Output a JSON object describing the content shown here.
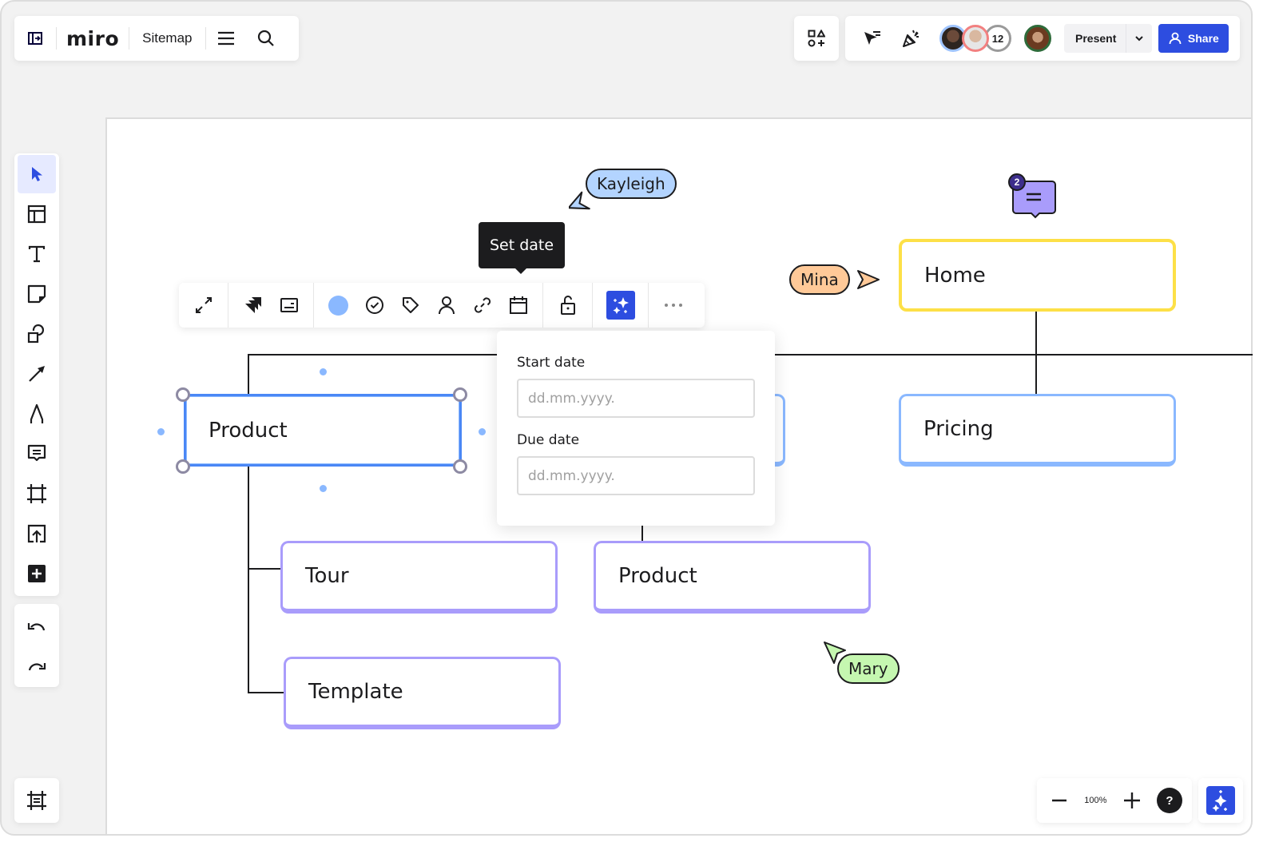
{
  "header": {
    "logo": "miro",
    "board_name": "Sitemap",
    "collaborator_count": "12",
    "present_label": "Present",
    "share_label": "Share"
  },
  "icons": {
    "sidebar_toggle": "sidebar-toggle-icon",
    "menu": "hamburger-menu-icon",
    "search": "search-icon",
    "apps": "shapes-apps-icon",
    "cursor_follow": "cursor-filter-icon",
    "reactions": "party-popper-icon",
    "chevron": "chevron-down-icon",
    "share": "user-icon"
  },
  "toolbar": {
    "tools": [
      {
        "name": "select",
        "icon": "cursor-arrow-icon",
        "active": true
      },
      {
        "name": "templates",
        "icon": "layout-template-icon"
      },
      {
        "name": "text",
        "icon": "text-icon"
      },
      {
        "name": "sticky-note",
        "icon": "sticky-note-icon"
      },
      {
        "name": "shapes",
        "icon": "shapes-icon"
      },
      {
        "name": "connection-line",
        "icon": "arrow-line-icon"
      },
      {
        "name": "pen",
        "icon": "pen-icon"
      },
      {
        "name": "comment",
        "icon": "comment-icon"
      },
      {
        "name": "frame",
        "icon": "frame-icon"
      },
      {
        "name": "upload",
        "icon": "upload-icon"
      },
      {
        "name": "more-tools",
        "icon": "plus-square-icon"
      }
    ],
    "undo": "undo-icon",
    "redo": "redo-icon",
    "frames": "frames-list-icon"
  },
  "context_toolbar": {
    "tooltip": "Set date",
    "color": "#8ab8ff",
    "buttons": [
      "expand-icon",
      "jira-icon",
      "card-icon",
      "color-swatch",
      "check-circle-icon",
      "tag-icon",
      "assignee-icon",
      "link-icon",
      "calendar-icon",
      "unlock-icon",
      "ai-sparkle-icon",
      "more-icon"
    ]
  },
  "date_popover": {
    "start_label": "Start date",
    "start_placeholder": "dd.mm.yyyy.",
    "start_value": "",
    "due_label": "Due date",
    "due_placeholder": "dd.mm.yyyy.",
    "due_value": ""
  },
  "sitemap": {
    "nodes": [
      {
        "id": "home",
        "label": "Home",
        "color": "#fde047"
      },
      {
        "id": "product-selected",
        "label": "Product",
        "color": "#4a87f5"
      },
      {
        "id": "pricing",
        "label": "Pricing",
        "color": "#8ab8ff"
      },
      {
        "id": "tour",
        "label": "Tour",
        "color": "#a99cfb"
      },
      {
        "id": "product-child",
        "label": "Product",
        "color": "#a99cfb"
      },
      {
        "id": "template",
        "label": "Template",
        "color": "#a99cfb"
      }
    ]
  },
  "cursors": [
    {
      "name": "Kayleigh",
      "color": "#b3d4ff"
    },
    {
      "name": "Mina",
      "color": "#ffc998"
    },
    {
      "name": "Mary",
      "color": "#c5f7b0"
    }
  ],
  "comment": {
    "count": "2",
    "color": "#a99cfb"
  },
  "zoom": {
    "level": "100%",
    "help": "?"
  }
}
